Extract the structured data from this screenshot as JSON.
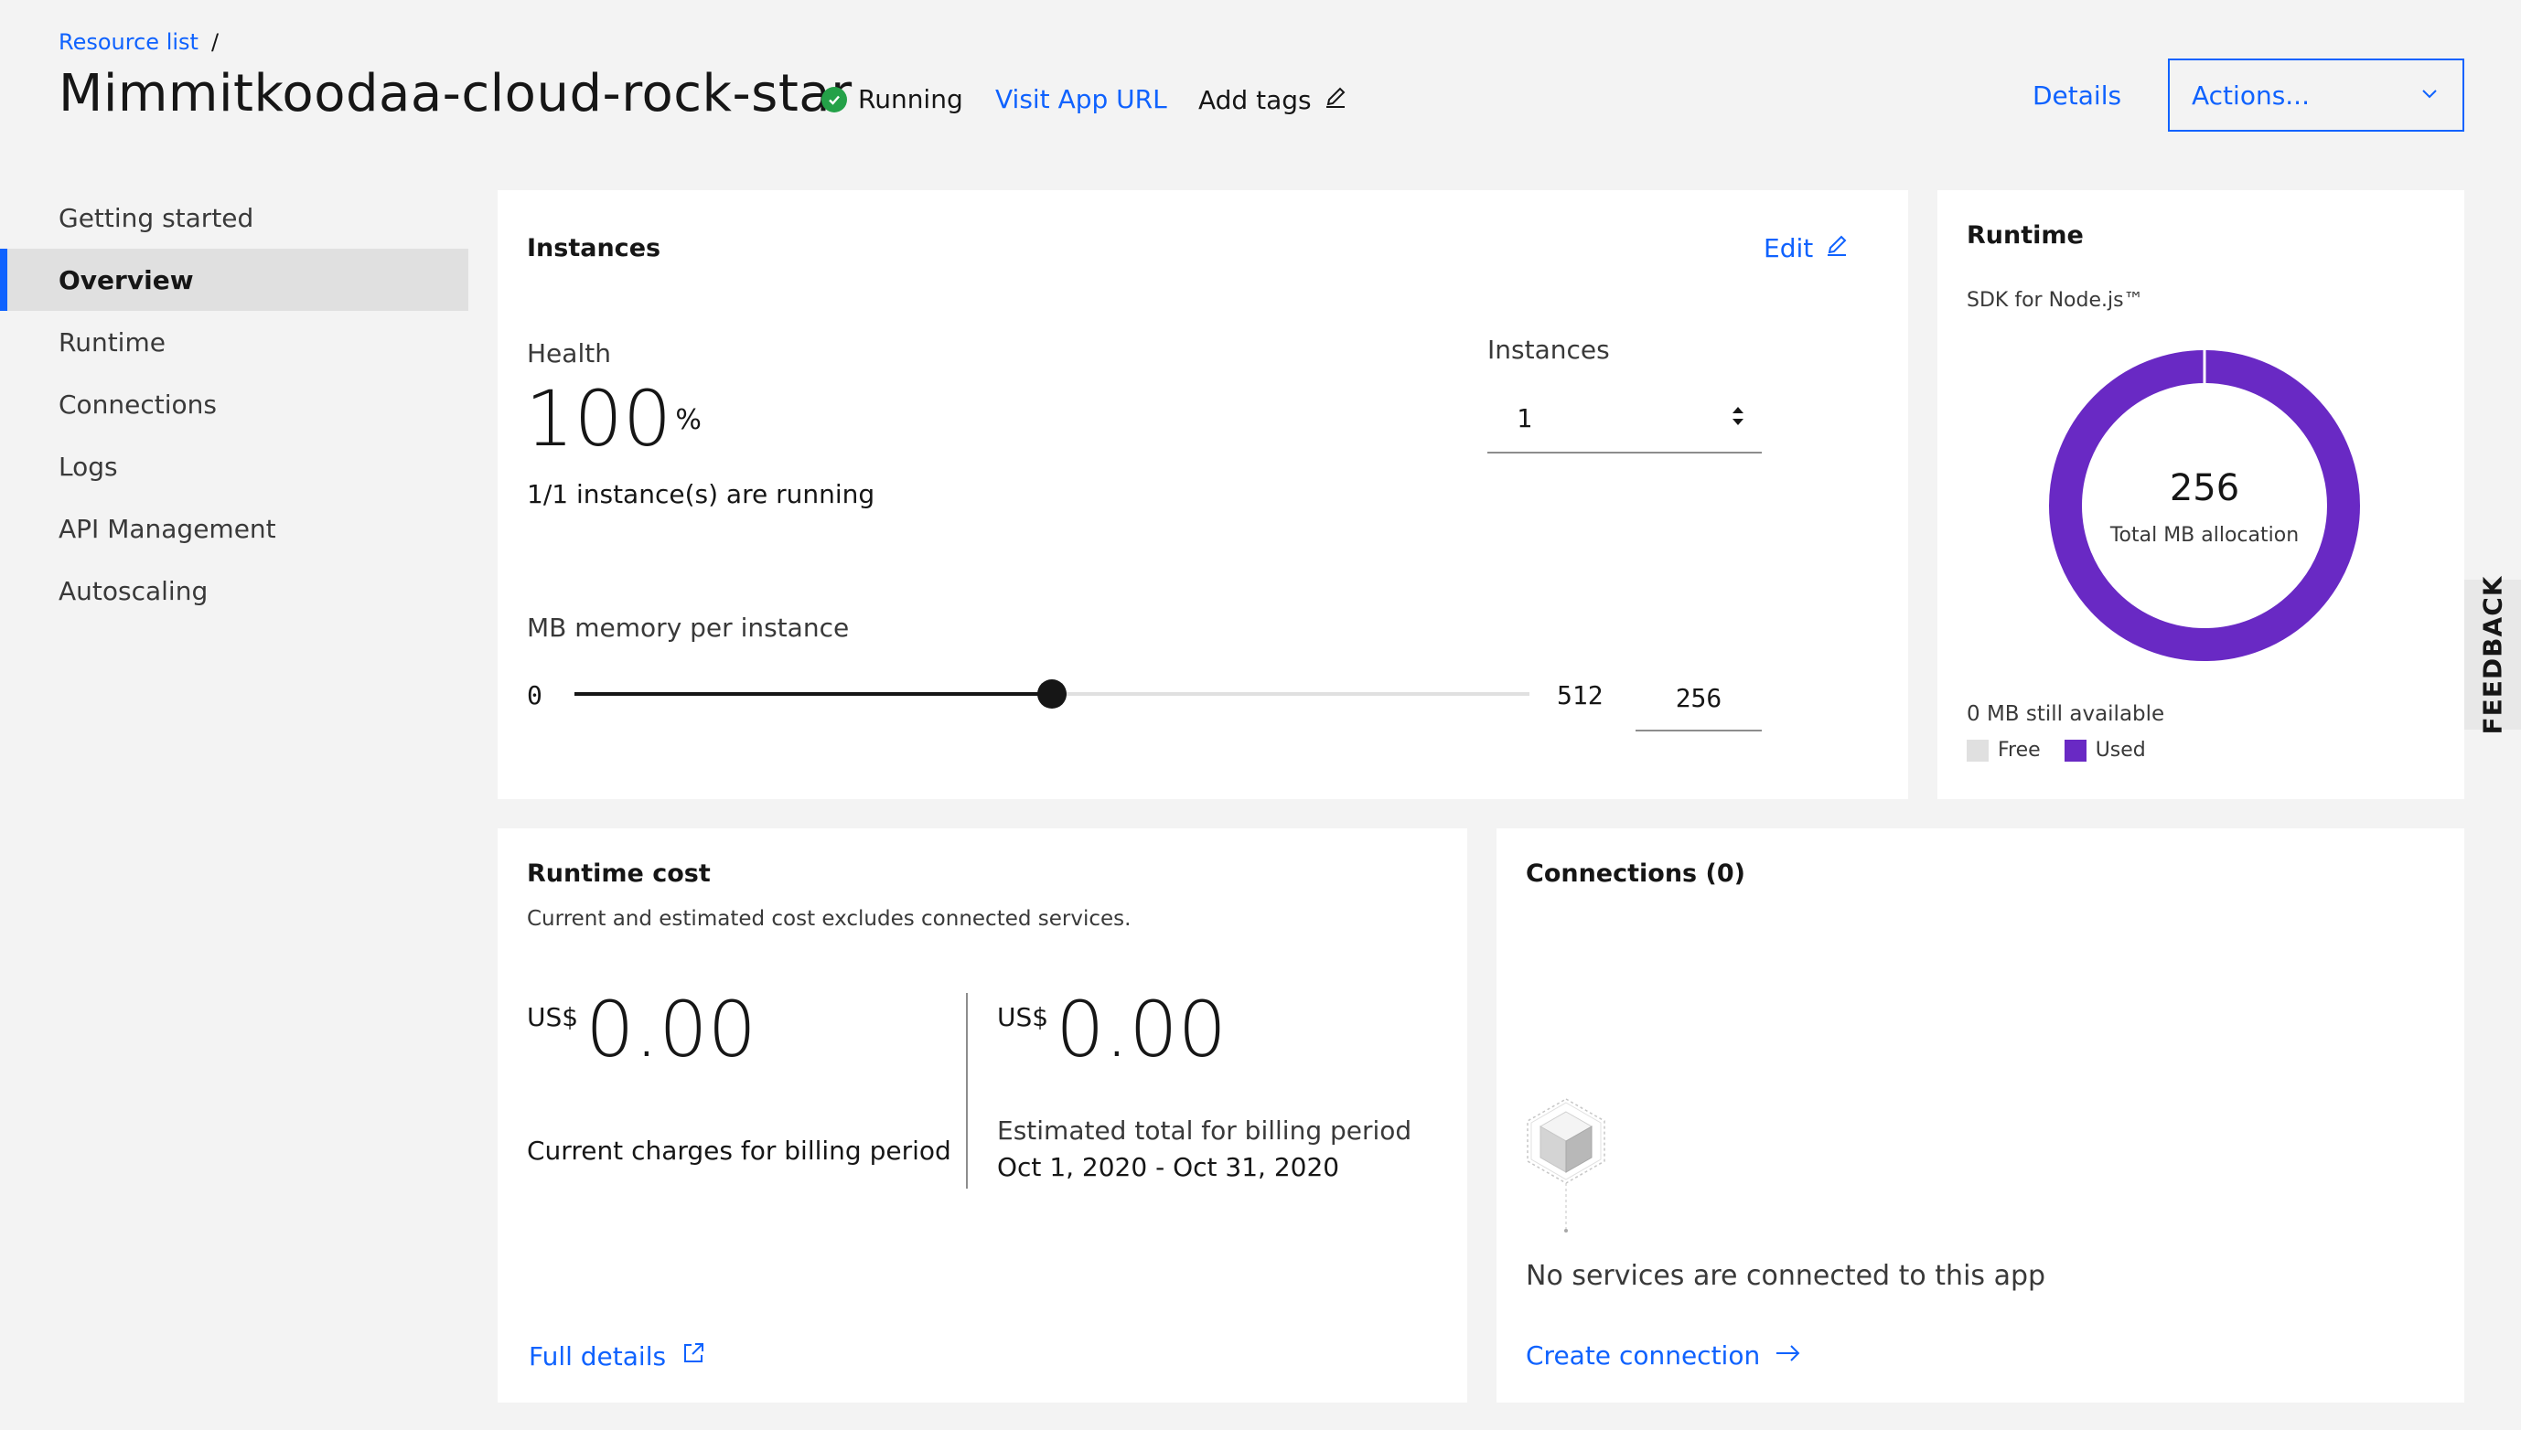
{
  "header": {
    "breadcrumb": "Resource list",
    "breadcrumb_sep": "/",
    "title": "Mimmitkoodaa-cloud-rock-star",
    "status": "Running",
    "visit_url": "Visit App URL",
    "add_tags": "Add tags",
    "details": "Details",
    "actions": "Actions..."
  },
  "sidebar": {
    "items": [
      {
        "label": "Getting started"
      },
      {
        "label": "Overview"
      },
      {
        "label": "Runtime"
      },
      {
        "label": "Connections"
      },
      {
        "label": "Logs"
      },
      {
        "label": "API Management"
      },
      {
        "label": "Autoscaling"
      }
    ],
    "active": "Overview"
  },
  "instances": {
    "title": "Instances",
    "edit": "Edit",
    "health_label": "Health",
    "health_value": "100",
    "health_unit": "%",
    "health_sub": "1/1 instance(s) are running",
    "instances_label": "Instances",
    "instances_value": "1",
    "memory_label": "MB memory per instance",
    "slider_min": "0",
    "slider_max": "512",
    "slider_value": "256",
    "slider_fraction": 0.5
  },
  "runtime": {
    "title": "Runtime",
    "sdk": "SDK for Node.js™",
    "total": "256",
    "total_label": "Total MB allocation",
    "available": "0 MB still available",
    "legend_free": "Free",
    "legend_used": "Used",
    "used_color": "#6929c4",
    "free_color": "#e0e0e0"
  },
  "cost": {
    "title": "Runtime cost",
    "subtitle": "Current and estimated cost excludes connected services.",
    "currency": "US$",
    "current_value": "0.00",
    "current_label": "Current charges for billing period",
    "estimated_value": "0.00",
    "estimated_label": "Estimated total for billing period",
    "period": "Oct 1, 2020 - Oct 31, 2020",
    "full_details": "Full details"
  },
  "connections": {
    "title": "Connections (0)",
    "empty": "No services are connected to this app",
    "create": "Create connection"
  },
  "feedback": "FEEDBACK"
}
